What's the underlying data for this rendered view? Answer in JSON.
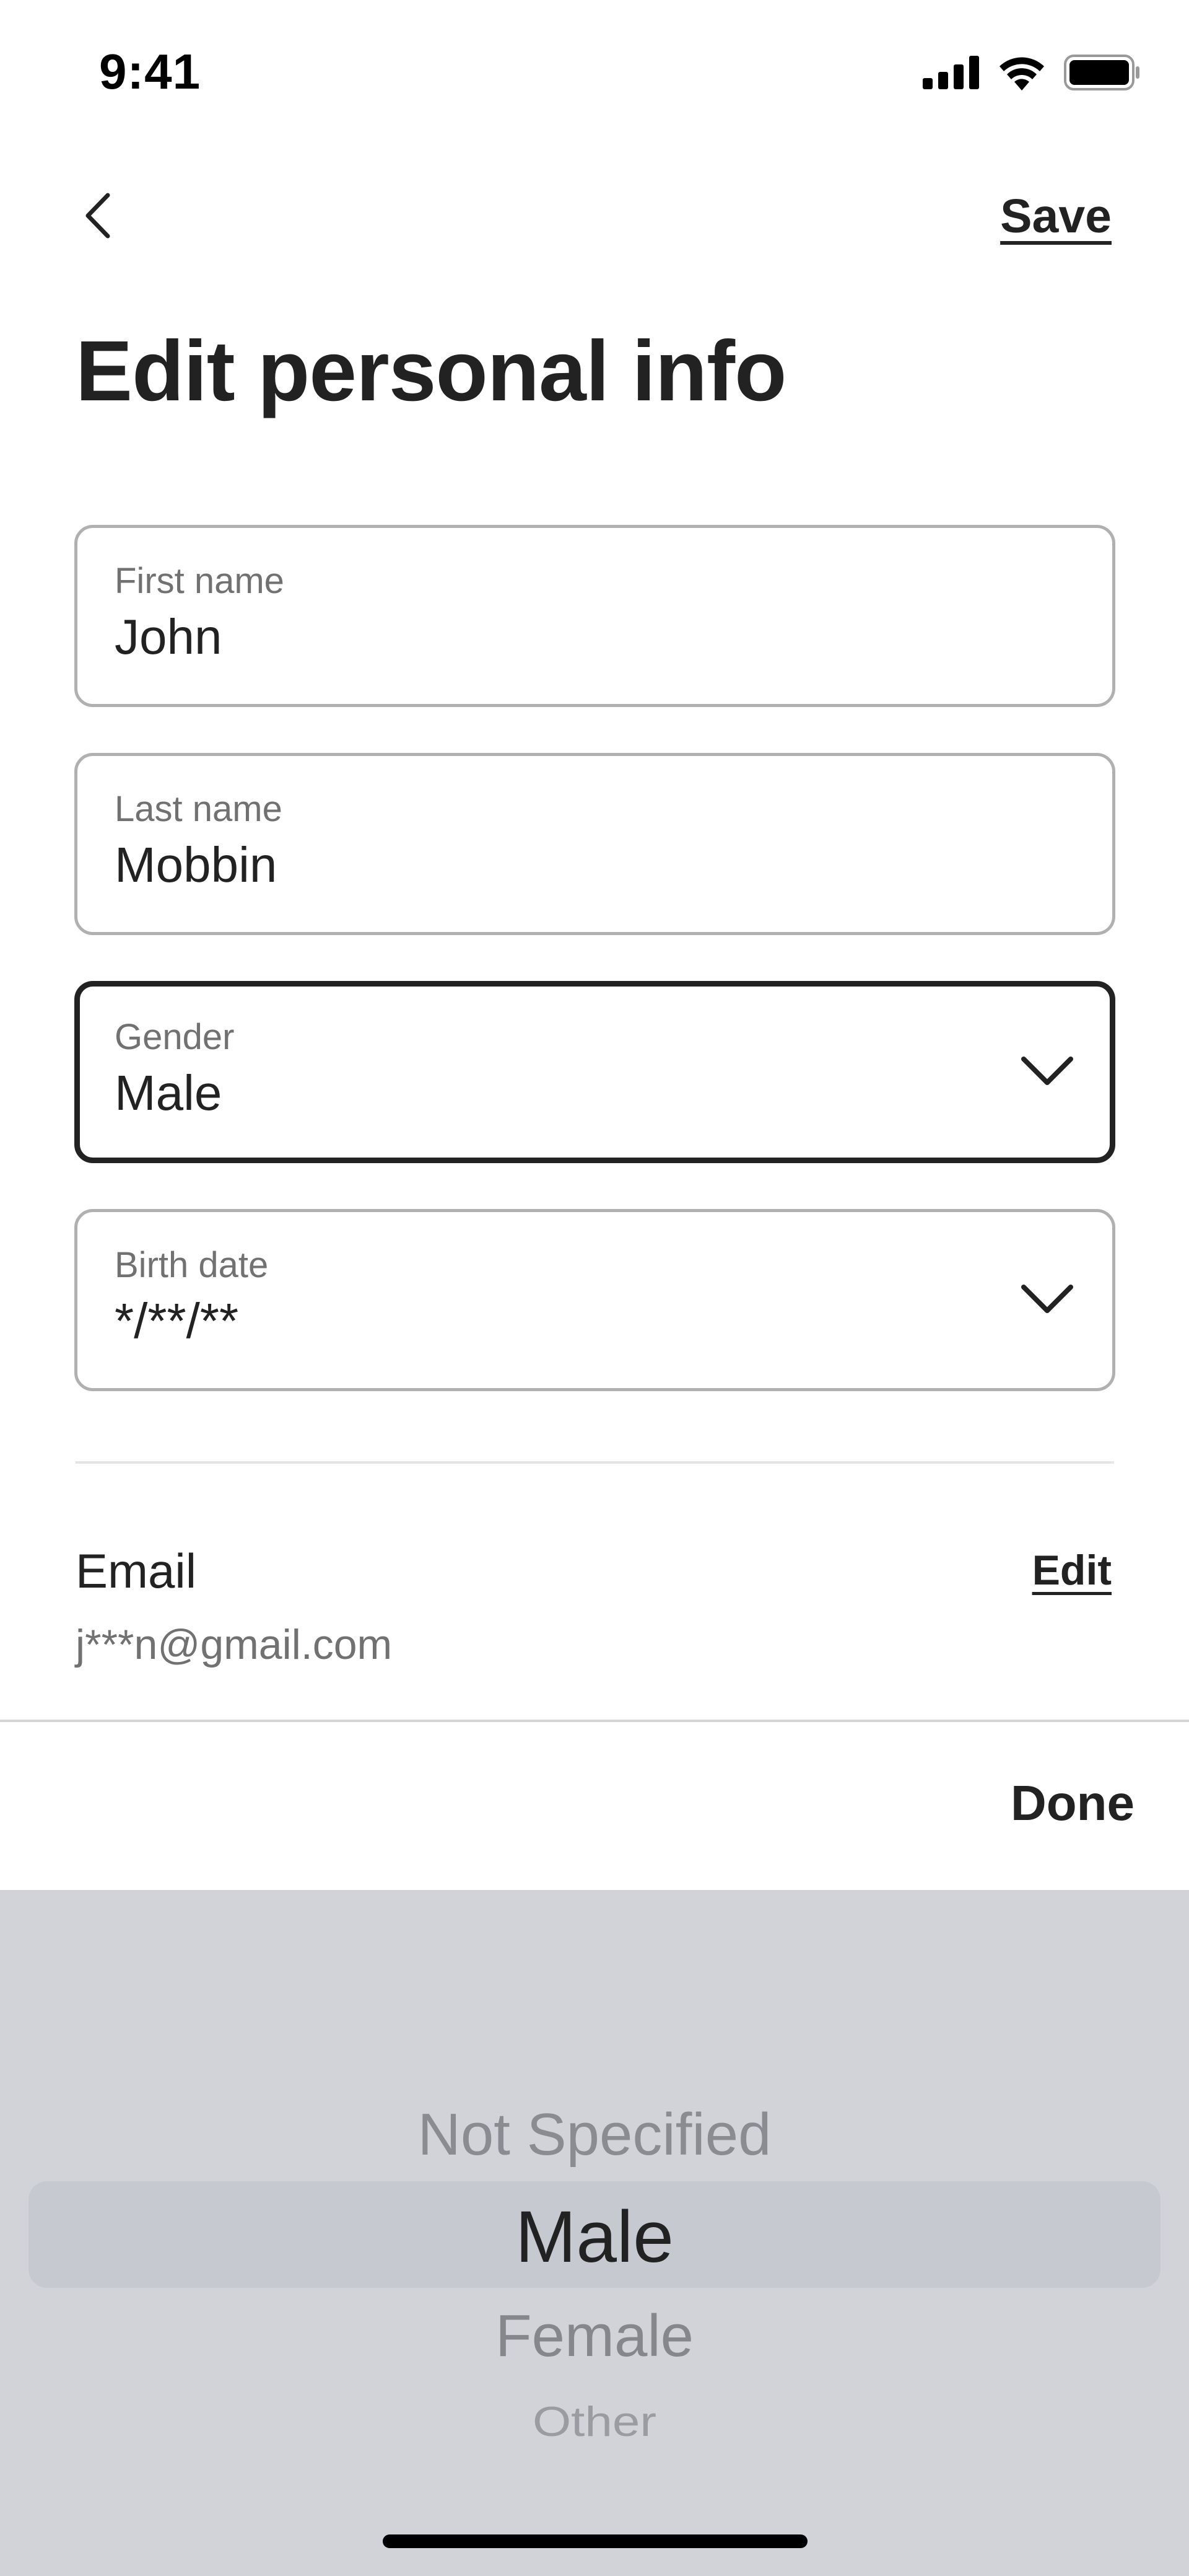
{
  "status_bar": {
    "time": "9:41",
    "icons": [
      "signal-icon",
      "wifi-icon",
      "battery-icon"
    ]
  },
  "nav": {
    "back_icon": "chevron-left-icon",
    "save_label": "Save"
  },
  "page": {
    "title": "Edit personal info"
  },
  "form": {
    "first_name": {
      "label": "First name",
      "value": "John"
    },
    "last_name": {
      "label": "Last name",
      "value": "Mobbin"
    },
    "gender": {
      "label": "Gender",
      "value": "Male",
      "icon": "chevron-down-icon"
    },
    "birth_date": {
      "label": "Birth date",
      "value": "*/**/**",
      "icon": "chevron-down-icon"
    }
  },
  "email": {
    "label": "Email",
    "value": "j***n@gmail.com",
    "edit_label": "Edit"
  },
  "picker": {
    "done_label": "Done",
    "options": [
      "Not Specified",
      "Male",
      "Female",
      "Other"
    ],
    "selected": "Male"
  },
  "colors": {
    "text_primary": "#222222",
    "text_secondary": "#717171",
    "field_border": "#b0b0b0",
    "picker_bg": "#d1d3d9",
    "picker_highlight": "#c7c9d0"
  }
}
